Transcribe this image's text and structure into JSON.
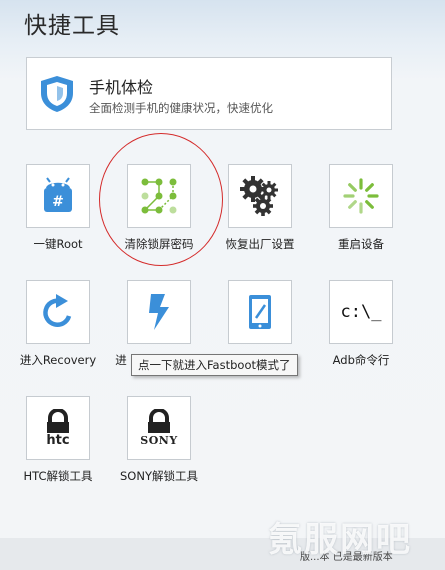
{
  "header": {
    "title": "快捷工具"
  },
  "card": {
    "title": "手机体检",
    "subtitle": "全面检测手机的健康状况，快速优化"
  },
  "tools": [
    {
      "label": "一键Root",
      "icon": "android-root-icon"
    },
    {
      "label": "清除锁屏密码",
      "icon": "pattern-lock-icon"
    },
    {
      "label": "恢复出厂设置",
      "icon": "gears-icon"
    },
    {
      "label": "重启设备",
      "icon": "loading-spinner-icon"
    },
    {
      "label": "进入Recovery",
      "icon": "refresh-icon"
    },
    {
      "label": "进",
      "icon": "lightning-icon"
    },
    {
      "label": "",
      "icon": "tablet-pen-icon"
    },
    {
      "label": "Adb命令行",
      "icon_text": "c:\\_"
    },
    {
      "label": "HTC解锁工具",
      "icon_text": "htc"
    },
    {
      "label": "SONY解锁工具",
      "icon_text": "SONY"
    }
  ],
  "tooltip": {
    "text": "点一下就进入Fastboot模式了"
  },
  "watermark": {
    "text": "氪服网吧"
  },
  "footer": {
    "text": "版...本  已是最新版本"
  },
  "colors": {
    "accent": "#3b8fd9",
    "green": "#7cbd3b",
    "dark": "#333333",
    "ring": "#d42b2b"
  }
}
